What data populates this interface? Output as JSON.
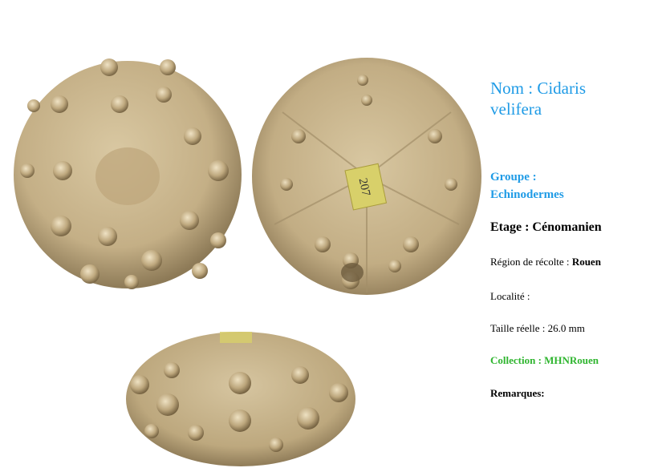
{
  "specimen": {
    "name_line1": "Nom : Cidaris",
    "name_line2": "velifera",
    "group_line1": "Groupe :",
    "group_line2": "Echinodermes",
    "stage": "Etage : Cénomanien",
    "region_label": "Région de récolte :",
    "region_value": "Rouen",
    "locality": "Localité :",
    "size": "Taille réelle : 26.0 mm",
    "collection": "Collection : MHNRouen",
    "remarks": "Remarques:",
    "label_tag": "207"
  },
  "colors": {
    "title": "#1f9be6",
    "group": "#1f9be6",
    "collection": "#2fb52f",
    "fossil_base": "#cbb892",
    "fossil_shadow": "#8a7653",
    "label_tag": "#d8d06a"
  },
  "images": [
    {
      "name": "fossil-top-view",
      "description_icon": "sea-urchin-top"
    },
    {
      "name": "fossil-bottom-view",
      "description_icon": "sea-urchin-bottom"
    },
    {
      "name": "fossil-side-view",
      "description_icon": "sea-urchin-side"
    }
  ]
}
